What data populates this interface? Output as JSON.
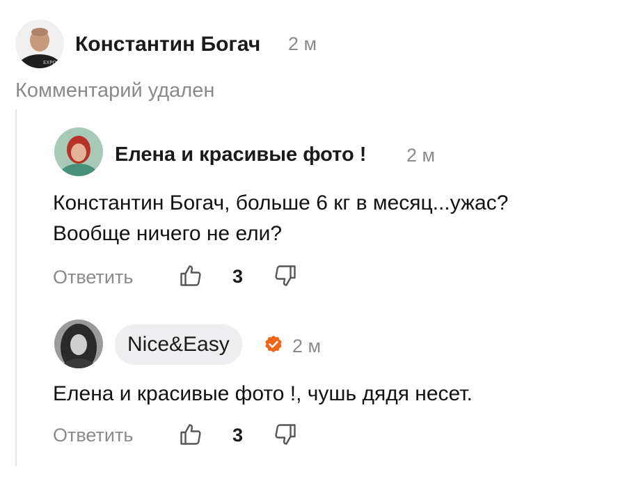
{
  "comment_root": {
    "author": "Константин Богач",
    "time": "2 м",
    "deleted_text": "Комментарий удален"
  },
  "replies": [
    {
      "author": "Елена и красивые фото !",
      "time": "2 м",
      "text_lines": [
        "Константин Богач, больше 6 кг в месяц...ужас?",
        "Вообще ничего не ели?"
      ],
      "reply_label": "Ответить",
      "likes": "3",
      "verified": false
    },
    {
      "author": "Nice&Easy",
      "time": "2 м",
      "text_lines": [
        "Елена и красивые фото !, чушь дядя несет."
      ],
      "reply_label": "Ответить",
      "likes": "3",
      "verified": true
    }
  ],
  "colors": {
    "verified_badge": "#f06418",
    "muted_text": "#8a8a8a",
    "author_pill_bg": "#eeeef0"
  },
  "icons": {
    "like": "thumbs-up-icon",
    "dislike": "thumbs-down-icon",
    "verified": "verified-badge-icon"
  }
}
